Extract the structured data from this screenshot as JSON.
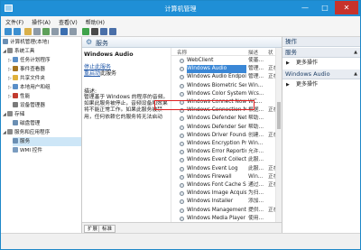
{
  "window": {
    "title": "计算机管理",
    "minimize": "—",
    "maximize": "□",
    "close": "✕"
  },
  "menu": [
    "文件(F)",
    "操作(A)",
    "查看(V)",
    "帮助(H)"
  ],
  "toolbar": {
    "icons": [
      "back-icon",
      "forward-icon",
      "up-icon",
      "properties-icon",
      "refresh-icon",
      "export-icon",
      "help-icon",
      "view-icon",
      "play-icon",
      "stop-icon",
      "pause-icon",
      "restart-icon"
    ]
  },
  "tree": [
    {
      "label": "计算机管理(本地)",
      "indent": 0,
      "expander": "",
      "icon_color": "#6b8fb3"
    },
    {
      "label": "系统工具",
      "indent": 1,
      "expander": "◢",
      "icon_color": "#8a8a8a"
    },
    {
      "label": "任务计划程序",
      "indent": 2,
      "expander": "▷",
      "icon_color": "#5a8fc8"
    },
    {
      "label": "事件查看器",
      "indent": 2,
      "expander": "▷",
      "icon_color": "#a5741f"
    },
    {
      "label": "共享文件夹",
      "indent": 2,
      "expander": "▷",
      "icon_color": "#e0b13b"
    },
    {
      "label": "本地用户和组",
      "indent": 2,
      "expander": "▷",
      "icon_color": "#5a8fc8"
    },
    {
      "label": "性能",
      "indent": 2,
      "expander": "▷",
      "icon_color": "#c23a2e"
    },
    {
      "label": "设备管理器",
      "indent": 2,
      "expander": "",
      "icon_color": "#7a7a7a"
    },
    {
      "label": "存储",
      "indent": 1,
      "expander": "◢",
      "icon_color": "#8a8a8a"
    },
    {
      "label": "磁盘管理",
      "indent": 2,
      "expander": "",
      "icon_color": "#6b8fb3"
    },
    {
      "label": "服务和应用程序",
      "indent": 1,
      "expander": "◢",
      "icon_color": "#8a8a8a"
    },
    {
      "label": "服务",
      "indent": 2,
      "expander": "",
      "icon_color": "#6b8fb3",
      "selected": true
    },
    {
      "label": "WMI 控件",
      "indent": 2,
      "expander": "",
      "icon_color": "#7a9cc0"
    }
  ],
  "center": {
    "header_title": "服务",
    "selected_service": "Windows Audio",
    "stop_link": "停止此服务",
    "stop_suffix": "",
    "restart_link": "重启动",
    "restart_suffix": "此服务",
    "desc_label": "描述:",
    "desc_text": "管理基于 Windows 的程序的音频。如果此服务被停止，音频设备和效果将不能正常工作。如果此服务被禁用，任何依赖它的服务将无法启动"
  },
  "columns": {
    "name": "名称",
    "desc": "描述",
    "status": "状"
  },
  "services": [
    {
      "name": "WebClient",
      "desc": "使基...",
      "status": ""
    },
    {
      "name": "Windows Audio",
      "desc": "管理...",
      "status": "正在",
      "highlight": true
    },
    {
      "name": "Windows Audio Endpoint...",
      "desc": "管理...",
      "status": "正在"
    },
    {
      "name": "Windows Biometric Servi...",
      "desc": "Win...",
      "status": ""
    },
    {
      "name": "Windows Color System",
      "desc": "Wcs...",
      "status": ""
    },
    {
      "name": "Windows Connect Now -...",
      "desc": "WC...",
      "status": ""
    },
    {
      "name": "Windows Connection Ma...",
      "desc": "根据...",
      "status": "正在"
    },
    {
      "name": "Windows Defender Netw...",
      "desc": "帮助...",
      "status": ""
    },
    {
      "name": "Windows Defender Service",
      "desc": "帮助...",
      "status": ""
    },
    {
      "name": "Windows Driver Foundati...",
      "desc": "创建...",
      "status": "正在"
    },
    {
      "name": "Windows Encryption Pro...",
      "desc": "Win...",
      "status": ""
    },
    {
      "name": "Windows Error Reportin...",
      "desc": "允许...",
      "status": ""
    },
    {
      "name": "Windows Event Collector",
      "desc": "此服...",
      "status": ""
    },
    {
      "name": "Windows Event Log",
      "desc": "此服...",
      "status": "正在"
    },
    {
      "name": "Windows Firewall",
      "desc": "Win...",
      "status": "正在"
    },
    {
      "name": "Windows Font Cache Ser...",
      "desc": "通过...",
      "status": "正在"
    },
    {
      "name": "Windows Image Acquisiti...",
      "desc": "为扫...",
      "status": ""
    },
    {
      "name": "Windows Installer",
      "desc": "添加...",
      "status": ""
    },
    {
      "name": "Windows Management I...",
      "desc": "提供...",
      "status": "正在"
    },
    {
      "name": "Windows Media Player N...",
      "desc": "使用...",
      "status": ""
    }
  ],
  "tabs": {
    "extended": "扩展",
    "standard": "标准"
  },
  "actions": {
    "header1": "操作",
    "section1": "服务",
    "item1": "更多操作",
    "section2": "Windows Audio",
    "item2": "更多操作",
    "arrow_up": "▲",
    "arrow_right": "▶"
  },
  "colors": {
    "titlebar": "#1f8fd6",
    "highlight": "#3a87d6",
    "annotation_box": "#e02020"
  }
}
